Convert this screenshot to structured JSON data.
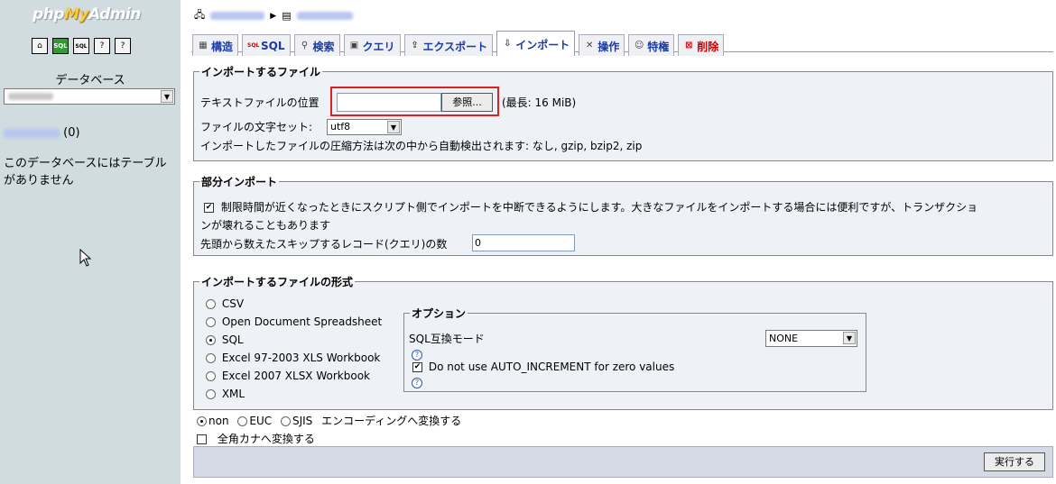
{
  "sidebar": {
    "logo_php": "php",
    "logo_my": "My",
    "logo_admin": "Admin",
    "nav_icons": [
      "home-icon",
      "sql-query-icon",
      "sql-window-icon",
      "docs-icon",
      "help-icon"
    ],
    "db_label": "データベース",
    "db_count": "(0)",
    "no_tables_text": "このデータベースにはテーブルがありません"
  },
  "breadcrumb": {
    "separator": "▶"
  },
  "tabs": [
    {
      "label": "構造",
      "icon": "structure-icon"
    },
    {
      "label": "SQL",
      "icon": "sql-icon"
    },
    {
      "label": "検索",
      "icon": "search-icon"
    },
    {
      "label": "クエリ",
      "icon": "query-icon"
    },
    {
      "label": "エクスポート",
      "icon": "export-icon"
    },
    {
      "label": "インポート",
      "icon": "import-icon",
      "active": true
    },
    {
      "label": "操作",
      "icon": "operations-icon"
    },
    {
      "label": "特権",
      "icon": "privileges-icon"
    },
    {
      "label": "削除",
      "icon": "drop-icon"
    }
  ],
  "file_section": {
    "legend": "インポートするファイル",
    "location_label": "テキストファイルの位置",
    "browse_label": "参照...",
    "max_size": "(最長: 16 MiB)",
    "charset_label": "ファイルの文字セット:",
    "charset_value": "utf8",
    "compression_note": "インポートしたファイルの圧縮方法は次の中から自動検出されます: なし, gzip, bzip2, zip"
  },
  "partial_section": {
    "legend": "部分インポート",
    "interrupt_label_line1": "制限時間が近くなったときにスクリプト側でインポートを中断できるようにします。大きなファイルをインポートする場合には便利ですが、トランザクショ",
    "interrupt_label_line2": "ンが壊れることもあります",
    "interrupt_checked": true,
    "skip_label": "先頭から数えたスキップするレコード(クエリ)の数",
    "skip_value": "0"
  },
  "format_section": {
    "legend": "インポートするファイルの形式",
    "formats": [
      {
        "label": "CSV",
        "selected": false
      },
      {
        "label": "Open Document Spreadsheet",
        "selected": false
      },
      {
        "label": "SQL",
        "selected": true
      },
      {
        "label": "Excel 97-2003 XLS Workbook",
        "selected": false
      },
      {
        "label": "Excel 2007 XLSX Workbook",
        "selected": false
      },
      {
        "label": "XML",
        "selected": false
      }
    ],
    "options_legend": "オプション",
    "sql_compat_label": "SQL互換モード",
    "sql_compat_value": "NONE",
    "auto_increment_label": "Do not use AUTO_INCREMENT for zero values",
    "auto_increment_checked": true
  },
  "encoding": {
    "none_label": "non",
    "euc_label": "EUC",
    "sjis_label": "SJIS",
    "suffix": "エンコーディングへ変換する",
    "kana_label": "全角カナへ変換する"
  },
  "submit_label": "実行する"
}
